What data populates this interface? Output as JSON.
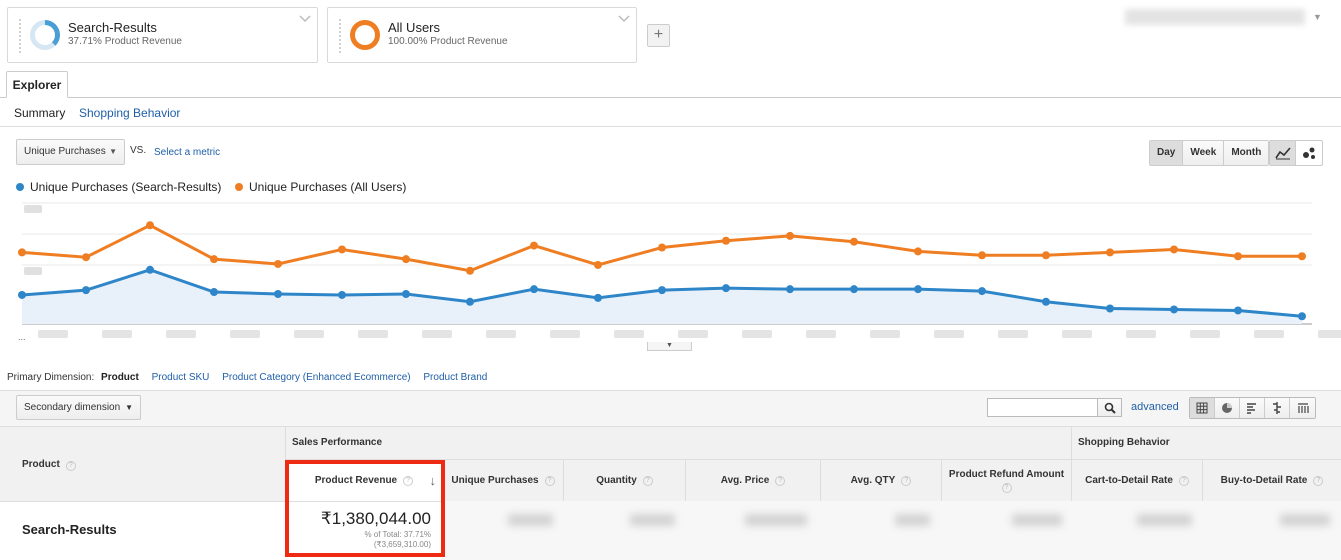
{
  "segments": [
    {
      "title": "Search-Results",
      "subtitle": "37.71% Product Revenue",
      "color": "#4a9ed6"
    },
    {
      "title": "All Users",
      "subtitle": "100.00% Product Revenue",
      "color": "#ef7d22"
    }
  ],
  "add_segment_label": "+",
  "tabs": {
    "explorer": "Explorer"
  },
  "subtabs": {
    "summary": "Summary",
    "shopping_behavior": "Shopping Behavior"
  },
  "metric": {
    "selected": "Unique Purchases",
    "vs": "VS.",
    "select_metric": "Select a metric"
  },
  "time_buttons": [
    {
      "label": "Day",
      "active": true
    },
    {
      "label": "Week",
      "active": false
    },
    {
      "label": "Month",
      "active": false
    }
  ],
  "legend": [
    {
      "label": "Unique Purchases (Search-Results)",
      "color": "#2e86c9"
    },
    {
      "label": "Unique Purchases (All Users)",
      "color": "#ef7d22"
    }
  ],
  "chart_data": {
    "type": "line",
    "series": [
      {
        "name": "Unique Purchases (All Users)",
        "color": "#ef7d22",
        "values": [
          74,
          69,
          102,
          67,
          62,
          77,
          67,
          55,
          81,
          61,
          79,
          86,
          91,
          85,
          75,
          71,
          71,
          74,
          77,
          70,
          70
        ]
      },
      {
        "name": "Unique Purchases (Search-Results)",
        "color": "#2e86c9",
        "values": [
          30,
          35,
          56,
          33,
          31,
          30,
          31,
          23,
          36,
          27,
          35,
          37,
          36,
          36,
          36,
          34,
          23,
          16,
          15,
          14,
          8
        ]
      }
    ],
    "ylim": [
      0,
      125
    ],
    "grid": true
  },
  "dimensions": {
    "label": "Primary Dimension:",
    "active": "Product",
    "links": [
      "Product SKU",
      "Product Category (Enhanced Ecommerce)",
      "Product Brand"
    ]
  },
  "secondary_dimension": "Secondary dimension",
  "advanced_label": "advanced",
  "table": {
    "group_headers": {
      "sales": "Sales Performance",
      "shopping": "Shopping Behavior"
    },
    "row_header": "Product",
    "columns": [
      "Product Revenue",
      "Unique Purchases",
      "Quantity",
      "Avg. Price",
      "Avg. QTY",
      "Product Refund Amount",
      "Cart-to-Detail Rate",
      "Buy-to-Detail Rate"
    ],
    "row": {
      "label": "Search-Results",
      "revenue": "₹1,380,044.00",
      "pct": "% of Total: 37.71%",
      "total": "(₹3,659,310.00)"
    }
  }
}
